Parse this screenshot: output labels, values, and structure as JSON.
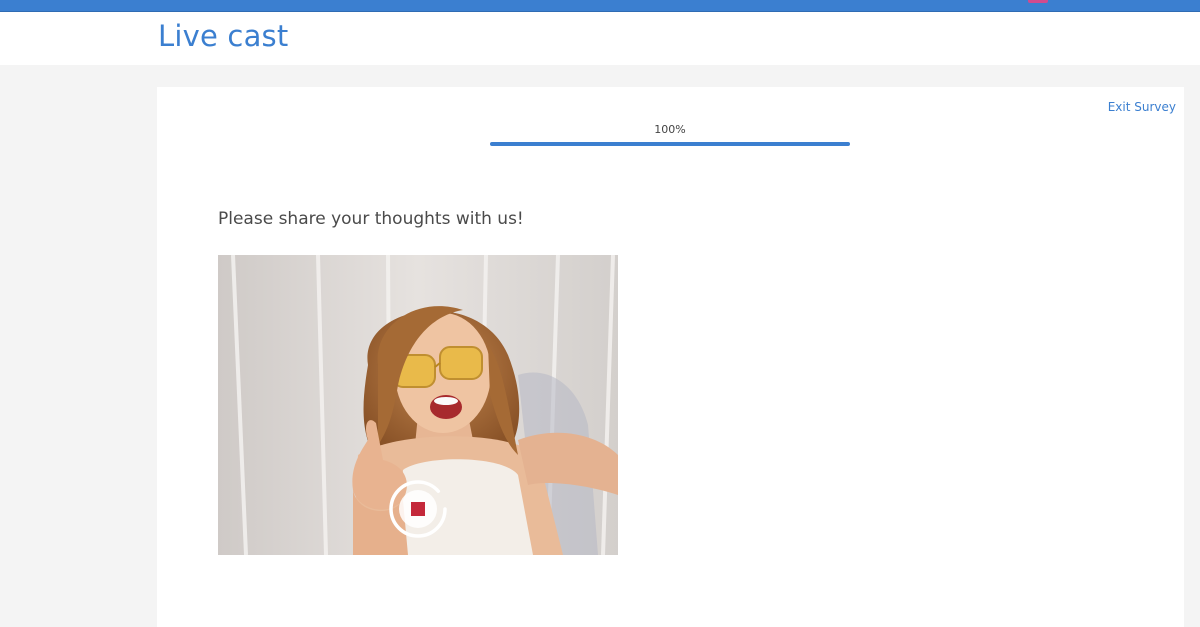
{
  "header": {
    "title": "Live cast"
  },
  "survey": {
    "exit_label": "Exit Survey",
    "progress_label": "100%",
    "progress_value": 1.0,
    "question": "Please share your thoughts with us!"
  },
  "recorder": {
    "stop_icon": "stop-icon",
    "state": "recording"
  },
  "colors": {
    "accent": "#3b7fd0",
    "stop": "#c4283a"
  }
}
